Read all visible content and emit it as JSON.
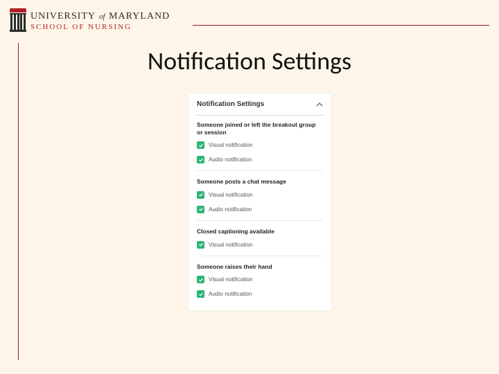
{
  "brand": {
    "line1_a": "UNIVERSITY",
    "line1_of": "of",
    "line1_b": "MARYLAND",
    "line2": "SCHOOL OF NURSING"
  },
  "slide": {
    "title": "Notification Settings"
  },
  "panel": {
    "title": "Notification Settings",
    "sections": [
      {
        "title": "Someone joined or left the breakout group or session",
        "options": [
          {
            "label": "Visual notification"
          },
          {
            "label": "Audio notification"
          }
        ]
      },
      {
        "title": "Someone posts a chat message",
        "options": [
          {
            "label": "Visual notification"
          },
          {
            "label": "Audio notification"
          }
        ]
      },
      {
        "title": "Closed captioning available",
        "options": [
          {
            "label": "Visual notification"
          }
        ]
      },
      {
        "title": "Someone raises their hand",
        "options": [
          {
            "label": "Visual notification"
          },
          {
            "label": "Audio notification"
          }
        ]
      }
    ]
  }
}
